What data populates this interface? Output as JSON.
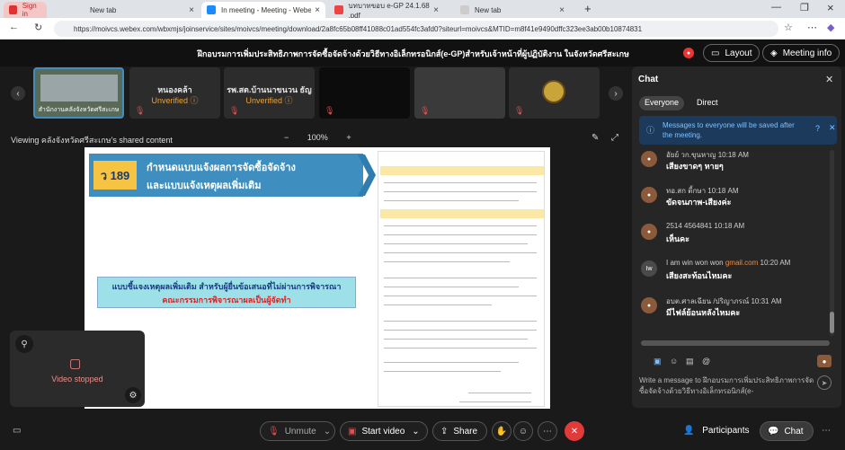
{
  "browser": {
    "tabs": [
      {
        "label": "Sign in",
        "active": false
      },
      {
        "label": "New tab",
        "active": false
      },
      {
        "label": "In meeting - Meeting - Webex",
        "active": true
      },
      {
        "label": "บทบาทขอบ e-GP 24.1.68 .pdf",
        "active": false
      },
      {
        "label": "New tab",
        "active": false
      }
    ],
    "url": "https://moivcs.webex.com/wbxmjs/joinservice/sites/moivcs/meeting/download/2a8fc65b08ff41088c01ad554fc3afd0?siteurl=moivcs&MTID=m8f41e9490dffc323ee3ab00b10874831"
  },
  "meeting": {
    "title": "ฝึกอบรมการเพิ่มประสิทธิภาพการจัดซื้อจัดจ้างด้วยวิธีทางอิเล็กทรอนิกส์(e-GP)สำหรับเจ้าหน้าที่ผู้ปฏิบัติงาน ในจังหวัดศรีสะเกษ",
    "layout_label": "Layout",
    "info_label": "Meeting info"
  },
  "participants": [
    {
      "name": "สำนักงานคลังจังหวัดศรีสะเกษ",
      "status": "",
      "type": "video"
    },
    {
      "name": "หนองคล้า",
      "status": "Unverified",
      "type": "name"
    },
    {
      "name": "รพ.สต.บ้านนาขนวน ธัญ",
      "status": "Unverified",
      "type": "name"
    },
    {
      "name": "",
      "status": "",
      "type": "dark"
    },
    {
      "name": "",
      "status": "",
      "type": "gray"
    },
    {
      "name": "",
      "status": "",
      "type": "logo"
    }
  ],
  "share": {
    "label": "Viewing คลังจังหวัดศรีสะเกษ's shared content",
    "zoom": "100%",
    "zoom_out": "−",
    "zoom_in": "+"
  },
  "slide": {
    "badge": "ว 189",
    "title_line1": "กำหนดแบบแจ้งผลการจัดซื้อจัดจ้าง",
    "title_line2": "และแบบแจ้งเหตุผลเพิ่มเติม",
    "box_line1": "แบบชี้แจงเหตุผลเพิ่มเติม สำหรับผู้ยื่นข้อเสนอที่ไม่ผ่านการพิจารณา",
    "box_line2": "คณะกรรมการพิจารณาผลเป็นผู้จัดทำ"
  },
  "selfview": {
    "status": "Video stopped"
  },
  "toolbar": {
    "unmute": "Unmute",
    "start_video": "Start video",
    "share": "Share",
    "participants": "Participants",
    "chat": "Chat"
  },
  "chat": {
    "title": "Chat",
    "tab_everyone": "Everyone",
    "tab_direct": "Direct",
    "notice": "Messages to everyone will be saved after the meeting.",
    "messages": [
      {
        "sender": "อัยย์ วก.ขุนหาญ",
        "time": "10:18 AM",
        "text": "เสียงขาดๆ หายๆ",
        "initials": ""
      },
      {
        "sender": "ทอ.สก ตี้กษา",
        "time": "10:18 AM",
        "text": "ขัดจนภาพ-เสียงค่ะ",
        "initials": ""
      },
      {
        "sender": "2514 4564841",
        "time": "10:18 AM",
        "text": "เห็นคะ",
        "initials": ""
      },
      {
        "sender": "I am win won won",
        "sender_link": "gmail.com",
        "time": "10:20 AM",
        "text": "เสียงสะท้อนไหมคะ",
        "initials": "Iw"
      },
      {
        "sender": "อบต.ศาลเฉียน /ปริญาภรณ์",
        "time": "10:31 AM",
        "text": "มีไฟล์ย้อนหลังไหมคะ",
        "initials": ""
      }
    ],
    "input_placeholder": "Write a message to ฝึกอบรมการเพิ่มประสิทธิภาพการจัดซื้อจัดจ้างด้วยวิธีทางอิเล็กทรอนิกส์(e-"
  }
}
